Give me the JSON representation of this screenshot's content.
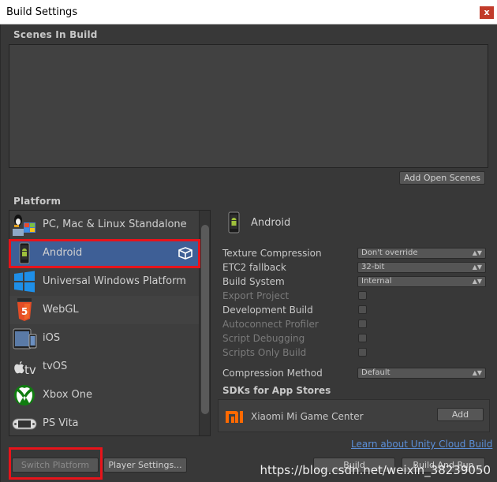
{
  "window": {
    "title": "Build Settings",
    "close_glyph": "x"
  },
  "scenes": {
    "heading": "Scenes In Build",
    "add_open_scenes_label": "Add Open Scenes"
  },
  "platform": {
    "heading": "Platform",
    "items": [
      {
        "label": "PC, Mac & Linux Standalone",
        "icon": "pc-mac-linux-icon"
      },
      {
        "label": "Android",
        "icon": "android-icon"
      },
      {
        "label": "Universal Windows Platform",
        "icon": "windows-icon"
      },
      {
        "label": "WebGL",
        "icon": "html5-icon"
      },
      {
        "label": "iOS",
        "icon": "ios-device-icon"
      },
      {
        "label": "tvOS",
        "icon": "apple-tv-icon"
      },
      {
        "label": "Xbox One",
        "icon": "xbox-icon"
      },
      {
        "label": "PS Vita",
        "icon": "ps-vita-icon"
      }
    ],
    "selected": "Android"
  },
  "settings": {
    "platform_title": "Android",
    "texture_compression": {
      "label": "Texture Compression",
      "value": "Don't override"
    },
    "etc2_fallback": {
      "label": "ETC2 fallback",
      "value": "32-bit"
    },
    "build_system": {
      "label": "Build System",
      "value": "Internal"
    },
    "export_project": {
      "label": "Export Project"
    },
    "development_build": {
      "label": "Development Build"
    },
    "autoconnect_profiler": {
      "label": "Autoconnect Profiler"
    },
    "script_debugging": {
      "label": "Script Debugging"
    },
    "scripts_only_build": {
      "label": "Scripts Only Build"
    },
    "compression_method": {
      "label": "Compression Method",
      "value": "Default"
    }
  },
  "sdks": {
    "heading": "SDKs for App Stores",
    "items": [
      {
        "name": "Xiaomi Mi Game Center",
        "action": "Add"
      }
    ]
  },
  "footer": {
    "cloud_build_link": "Learn about Unity Cloud Build",
    "switch_platform_label": "Switch Platform",
    "player_settings_label": "Player Settings...",
    "build_label": "Build",
    "build_and_run_label": "Build And Run"
  },
  "watermark": "https://blog.csdn.net/weixin_38239050",
  "colors": {
    "selected_row": "#3e5f96",
    "highlight_box": "#e8131a",
    "link": "#5b8fd8",
    "close_button": "#c23b2a"
  }
}
